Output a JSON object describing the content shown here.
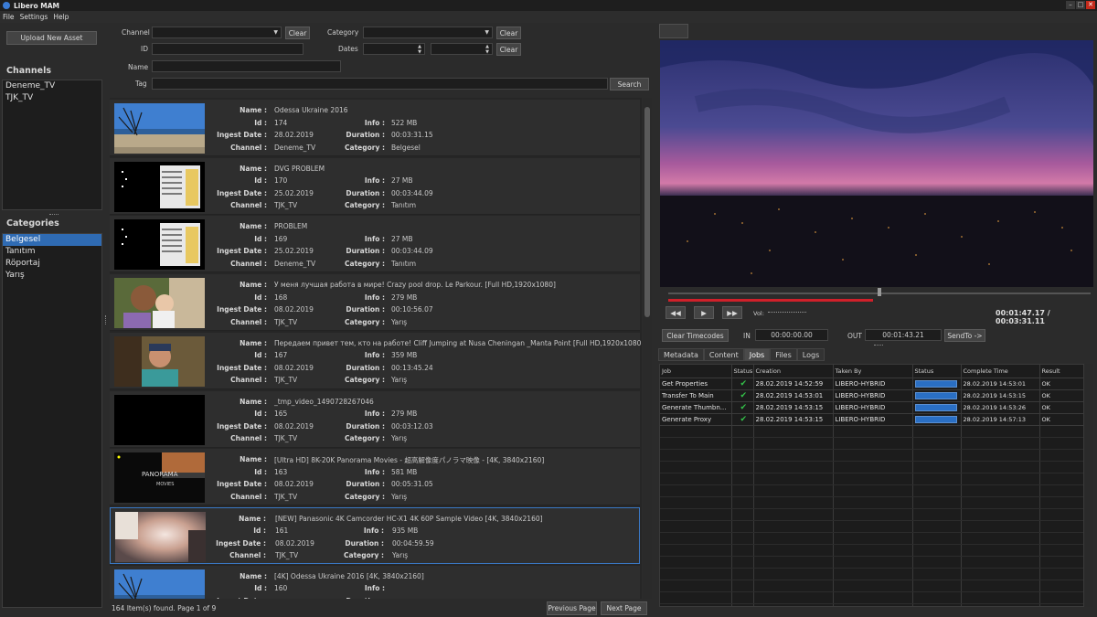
{
  "app": {
    "title": "Libero MAM"
  },
  "window": {
    "minimize": "–",
    "maximize": "□",
    "close": "✕"
  },
  "menu": [
    "File",
    "Settings",
    "Help"
  ],
  "left": {
    "upload_label": "Upload New Asset",
    "channels_title": "Channels",
    "channels": [
      "Deneme_TV",
      "TJK_TV"
    ],
    "categories_title": "Categories",
    "categories": [
      "Belgesel",
      "Tanıtım",
      "Röportaj",
      "Yarış"
    ],
    "selected_category": "Belgesel"
  },
  "search": {
    "channel_label": "Channel",
    "category_label": "Category",
    "id_label": "ID",
    "dates_label": "Dates",
    "name_label": "Name",
    "tag_label": "Tag",
    "clear_label": "Clear",
    "search_label": "Search"
  },
  "field_labels": {
    "name": "Name :",
    "id": "Id :",
    "info": "Info :",
    "ingest": "Ingest Date :",
    "duration": "Duration :",
    "channel": "Channel :",
    "category": "Category :"
  },
  "results": [
    {
      "name": "Odessa Ukraine 2016",
      "id": "174",
      "info": "522 MB",
      "ingest": "28.02.2019",
      "duration": "00:03:31.15",
      "channel": "Deneme_TV",
      "category": "Belgesel",
      "thumb": "beach"
    },
    {
      "name": "DVG PROBLEM",
      "id": "170",
      "info": "27 MB",
      "ingest": "25.02.2019",
      "duration": "00:03:44.09",
      "channel": "TJK_TV",
      "category": "Tanıtım",
      "thumb": "screen"
    },
    {
      "name": "PROBLEM",
      "id": "169",
      "info": "27 MB",
      "ingest": "25.02.2019",
      "duration": "00:03:44.09",
      "channel": "Deneme_TV",
      "category": "Tanıtım",
      "thumb": "screen"
    },
    {
      "name": "У меня лучшая работа в мире! Crazy pool drop. Le Parkour. [Full HD,1920x1080]",
      "id": "168",
      "info": "279 MB",
      "ingest": "08.02.2019",
      "duration": "00:10:56.07",
      "channel": "TJK_TV",
      "category": "Yarış",
      "thumb": "people"
    },
    {
      "name": "Передаем привет тем, кто на работе! Cliff Jumping at Nusa Cheningan _Manta Point [Full HD,1920x1080]",
      "id": "167",
      "info": "359 MB",
      "ingest": "08.02.2019",
      "duration": "00:13:45.24",
      "channel": "TJK_TV",
      "category": "Yarış",
      "thumb": "man"
    },
    {
      "name": "_tmp_video_1490728267046",
      "id": "165",
      "info": "279 MB",
      "ingest": "08.02.2019",
      "duration": "00:03:12.03",
      "channel": "TJK_TV",
      "category": "Yarış",
      "thumb": "black"
    },
    {
      "name": "[Ultra HD] 8K-20K Panorama Movies - 超高解像度パノラマ映像 - [4K, 3840x2160]",
      "id": "163",
      "info": "581 MB",
      "ingest": "08.02.2019",
      "duration": "00:05:31.05",
      "channel": "TJK_TV",
      "category": "Yarış",
      "thumb": "panorama"
    },
    {
      "name": "[NEW] Panasonic 4K Camcorder HC-X1 4K 60P Sample Video [4K, 3840x2160]",
      "id": "161",
      "info": "935 MB",
      "ingest": "08.02.2019",
      "duration": "00:04:59.59",
      "channel": "TJK_TV",
      "category": "Yarış",
      "thumb": "blur",
      "selected": true
    },
    {
      "name": "[4K] Odessa  Ukraine 2016 [4K, 3840x2160]",
      "id": "160",
      "info": "",
      "ingest": "",
      "duration": "",
      "channel": "",
      "category": "",
      "thumb": "beach"
    }
  ],
  "status": {
    "found": "164 Item(s) found. Page 1 of 9",
    "prev": "Previous Page",
    "next": "Next Page"
  },
  "player": {
    "position_fraction": 0.485,
    "current": "00:01:47.17",
    "total": "00:03:31.11",
    "vol_label": "Vol:",
    "clear_tc": "Clear Timecodes",
    "in_label": "IN",
    "in_value": "00:00:00.00",
    "out_label": "OUT",
    "out_value": "00:01:43.21",
    "sendto": "SendTo ->"
  },
  "tabs": [
    "Metadata",
    "Content",
    "Jobs",
    "Files",
    "Logs"
  ],
  "active_tab": "Jobs",
  "jobs": {
    "headers": [
      "Job",
      "Status",
      "Creation",
      "Taken By",
      "Status",
      "Complete Time",
      "Result"
    ],
    "rows": [
      {
        "job": "Get Properties",
        "creation": "28.02.2019 14:52:59",
        "taken_by": "LIBERO-HYBRID",
        "progress": 1.0,
        "complete": "28.02.2019 14:53:01",
        "result": "OK"
      },
      {
        "job": "Transfer To Main",
        "creation": "28.02.2019 14:53:01",
        "taken_by": "LIBERO-HYBRID",
        "progress": 1.0,
        "complete": "28.02.2019 14:53:15",
        "result": "OK"
      },
      {
        "job": "Generate Thumbn...",
        "creation": "28.02.2019 14:53:15",
        "taken_by": "LIBERO-HYBRID",
        "progress": 1.0,
        "complete": "28.02.2019 14:53:26",
        "result": "OK"
      },
      {
        "job": "Generate Proxy",
        "creation": "28.02.2019 14:53:15",
        "taken_by": "LIBERO-HYBRID",
        "progress": 1.0,
        "complete": "28.02.2019 14:57:13",
        "result": "OK"
      }
    ]
  }
}
